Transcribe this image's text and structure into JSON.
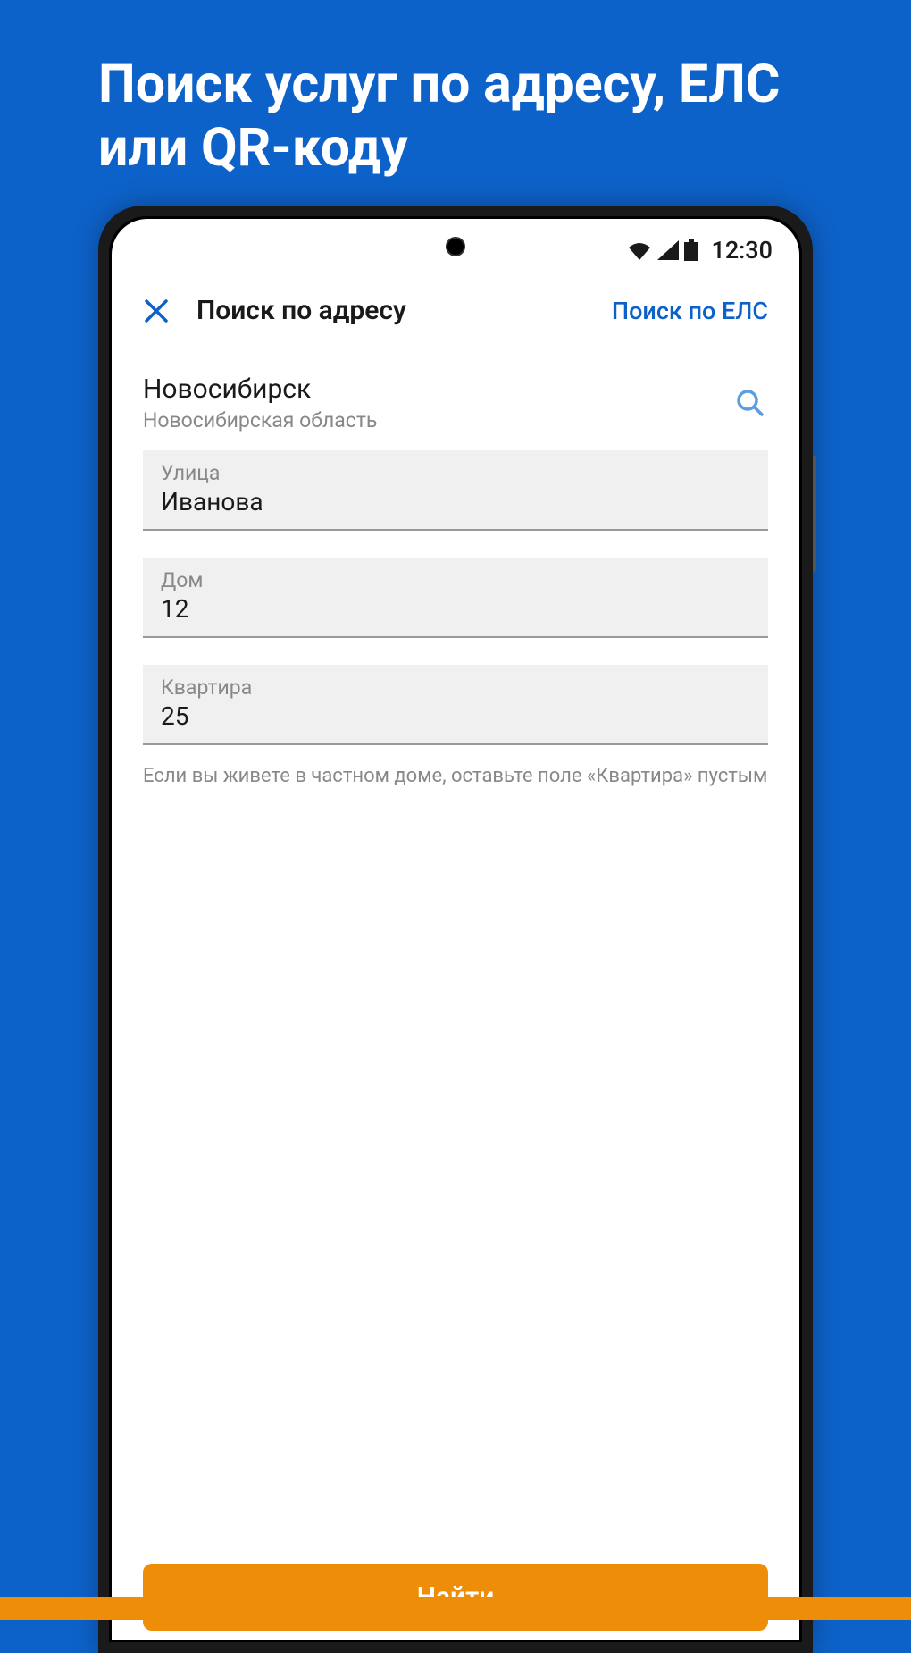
{
  "promo": {
    "title": "Поиск услуг по адресу, ЕЛС или QR-коду"
  },
  "status_bar": {
    "time": "12:30"
  },
  "header": {
    "title": "Поиск по адресу",
    "link": "Поиск по ЕЛС"
  },
  "city": {
    "name": "Новосибирск",
    "region": "Новосибирская область"
  },
  "fields": {
    "street": {
      "label": "Улица",
      "value": "Иванова"
    },
    "house": {
      "label": "Дом",
      "value": "12"
    },
    "apartment": {
      "label": "Квартира",
      "value": "25"
    }
  },
  "hint": "Если вы живете в частном доме, оставьте поле «Квартира» пустым",
  "find_button": "Найти"
}
